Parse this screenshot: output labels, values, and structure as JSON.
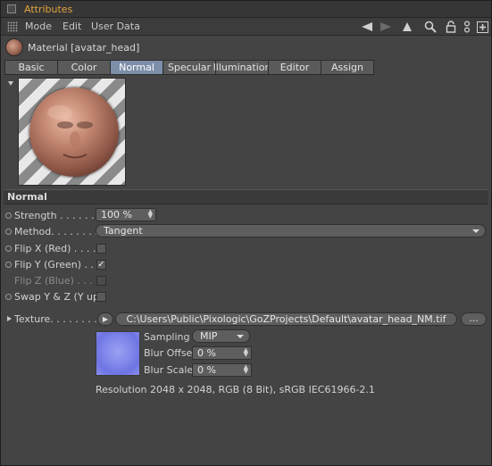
{
  "window": {
    "title": "Attributes"
  },
  "menu": {
    "items": [
      "Mode",
      "Edit",
      "User Data"
    ]
  },
  "toolbar": {
    "icons": [
      "arrow-left-icon",
      "arrow-right-icon",
      "arrow-up-icon",
      "search-icon",
      "lock-icon",
      "nodes-icon",
      "add-panel-icon"
    ]
  },
  "material": {
    "name": "Material [avatar_head]"
  },
  "tabs": [
    {
      "label": "Basic",
      "active": false
    },
    {
      "label": "Color",
      "active": false
    },
    {
      "label": "Normal",
      "active": true
    },
    {
      "label": "Specular",
      "active": false
    },
    {
      "label": "Illumination",
      "active": false
    },
    {
      "label": "Editor",
      "active": false
    },
    {
      "label": "Assign",
      "active": false
    }
  ],
  "section": {
    "title": "Normal"
  },
  "params": {
    "strength": {
      "label": "Strength . . . . . . . .",
      "value": "100 %"
    },
    "method": {
      "label": "Method. . . . . . . . .",
      "value": "Tangent"
    },
    "flip_x": {
      "label": "Flip X (Red) . . . . .",
      "checked": false
    },
    "flip_y": {
      "label": "Flip Y (Green) . . . .",
      "checked": true,
      "mark": "✓"
    },
    "flip_z": {
      "label": "Flip Z (Blue) . . . . .",
      "checked": false,
      "disabled": true
    },
    "swap_yz": {
      "label": "Swap Y & Z (Y up)",
      "checked": false
    }
  },
  "texture": {
    "label": "Texture. . . . . . . . .",
    "path": "C:\\Users\\Public\\Pixologic\\GoZProjects\\Default\\avatar_head_NM.tif",
    "browse_label": "...",
    "sampling": {
      "label": "Sampling",
      "value": "MIP"
    },
    "blur_offset": {
      "label": "Blur Offset",
      "value": "0 %"
    },
    "blur_scale": {
      "label": "Blur Scale",
      "value": "0 %"
    },
    "resolution": "Resolution 2048 x 2048, RGB (8 Bit), sRGB IEC61966-2.1"
  },
  "colors": {
    "accent_title": "#e2a43c",
    "active_tab": "#7c8ea8",
    "panel_bg": "#444444"
  }
}
